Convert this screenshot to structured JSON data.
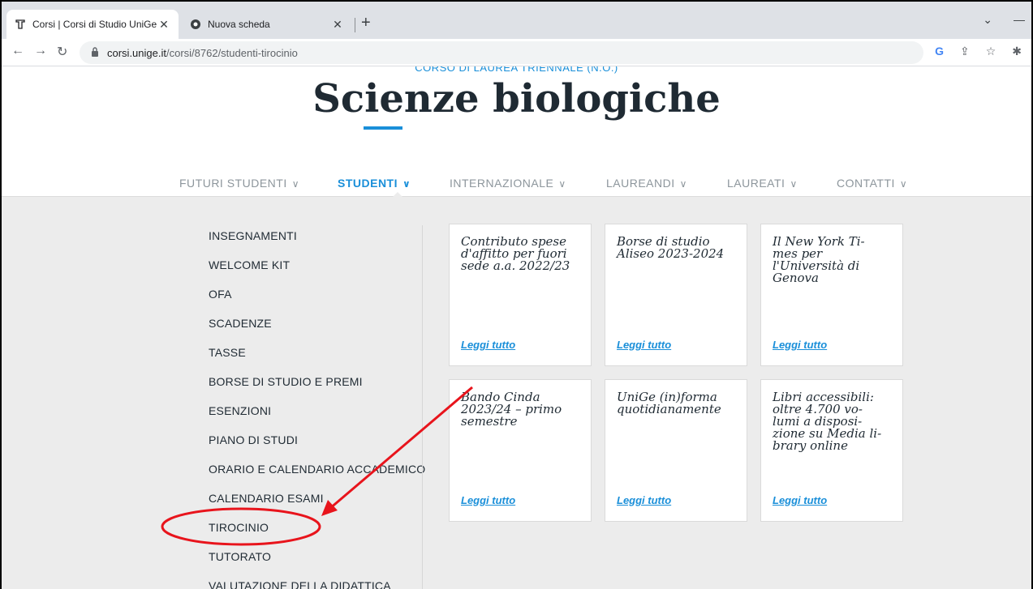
{
  "browser": {
    "tabs": [
      {
        "title": "Corsi | Corsi di Studio UniGe",
        "active": true
      },
      {
        "title": "Nuova scheda",
        "active": false
      }
    ],
    "url_host": "corsi.unige.it",
    "url_path": "/corsi/8762/studenti-tirocinio"
  },
  "site": {
    "kicker": "CORSO DI LAUREA TRIENNALE (N.O.)",
    "title": "Scienze biologiche"
  },
  "mainnav": [
    {
      "label": "FUTURI STUDENTI",
      "active": false
    },
    {
      "label": "STUDENTI",
      "active": true
    },
    {
      "label": "INTERNAZIONALE",
      "active": false
    },
    {
      "label": "LAUREANDI",
      "active": false
    },
    {
      "label": "LAUREATI",
      "active": false
    },
    {
      "label": "CONTATTI",
      "active": false
    }
  ],
  "sidemenu": [
    "INSEGNAMENTI",
    "WELCOME KIT",
    "OFA",
    "SCADENZE",
    "TASSE",
    "BORSE DI STUDIO E PREMI",
    "ESENZIONI",
    "PIANO DI STUDI",
    "ORARIO E CALENDARIO ACCADEMICO",
    "CALENDARIO ESAMI",
    "TIROCINIO",
    "TUTORATO",
    "VALUTAZIONE DELLA DIDATTICA"
  ],
  "cards": [
    {
      "lines": [
        "Contributo spese",
        "d'affitto per fuori",
        "sede a.a. 2022/23"
      ],
      "link": "Leggi tutto"
    },
    {
      "lines": [
        "Borse di studio",
        "Aliseo 2023-2024"
      ],
      "link": "Leggi tutto"
    },
    {
      "lines": [
        "Il New York Ti-",
        "mes per",
        "l'Università di",
        "Genova"
      ],
      "link": "Leggi tutto"
    },
    {
      "lines": [
        "Bando Cinda",
        "2023/24 – primo",
        "semestre"
      ],
      "link": "Leggi tutto"
    },
    {
      "lines": [
        "UniGe (in)forma",
        "quotidianamente"
      ],
      "link": "Leggi tutto"
    },
    {
      "lines": [
        "Libri accessibili:",
        "oltre 4.700 vo-",
        "lumi a disposi-",
        "zione su Media li-",
        "brary online"
      ],
      "link": "Leggi tutto"
    }
  ],
  "annotation": {
    "color": "#e8141c"
  }
}
